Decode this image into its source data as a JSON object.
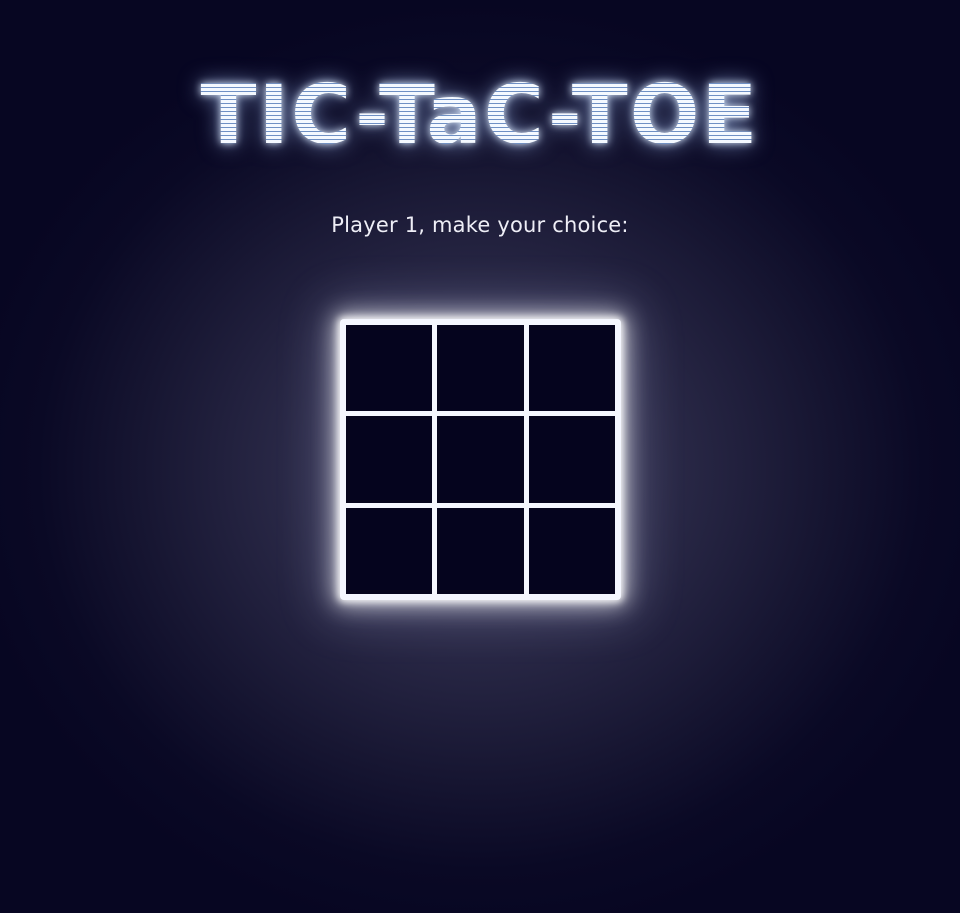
{
  "title": {
    "part1": "TIC",
    "sep1": "-",
    "part2": "TaC",
    "sep2": "-",
    "part3": "TOE"
  },
  "status": {
    "prompt": "Player 1, make your choice:"
  },
  "board": {
    "cells": [
      "",
      "",
      "",
      "",
      "",
      "",
      "",
      "",
      ""
    ]
  },
  "colors": {
    "background": "#070622",
    "glow": "#f4f6ff",
    "cell": "#05041e"
  }
}
